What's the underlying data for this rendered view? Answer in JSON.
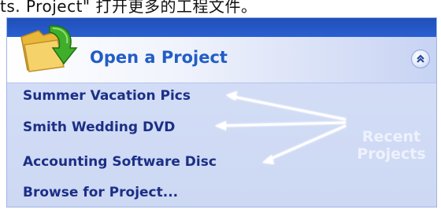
{
  "caption": {
    "text": "ts. Project\" 打开更多的工程文件。"
  },
  "panel": {
    "title": "Open a Project",
    "collapse_icon": "double-chevron-up-icon",
    "folder_icon": "folder-open-arrow-icon"
  },
  "projects": [
    {
      "label": "Summer Vacation Pics"
    },
    {
      "label": "Smith Wedding DVD"
    },
    {
      "label": "Accounting Software Disc"
    },
    {
      "label": "Browse for Project..."
    }
  ],
  "annotation": {
    "line1": "Recent",
    "line2": "Projects"
  },
  "colors": {
    "header_band": "#2a5fd0",
    "title": "#215dc6",
    "link": "#1b2f86",
    "panel_bg": "#d5dff7",
    "annotation": "#eef2fd"
  }
}
